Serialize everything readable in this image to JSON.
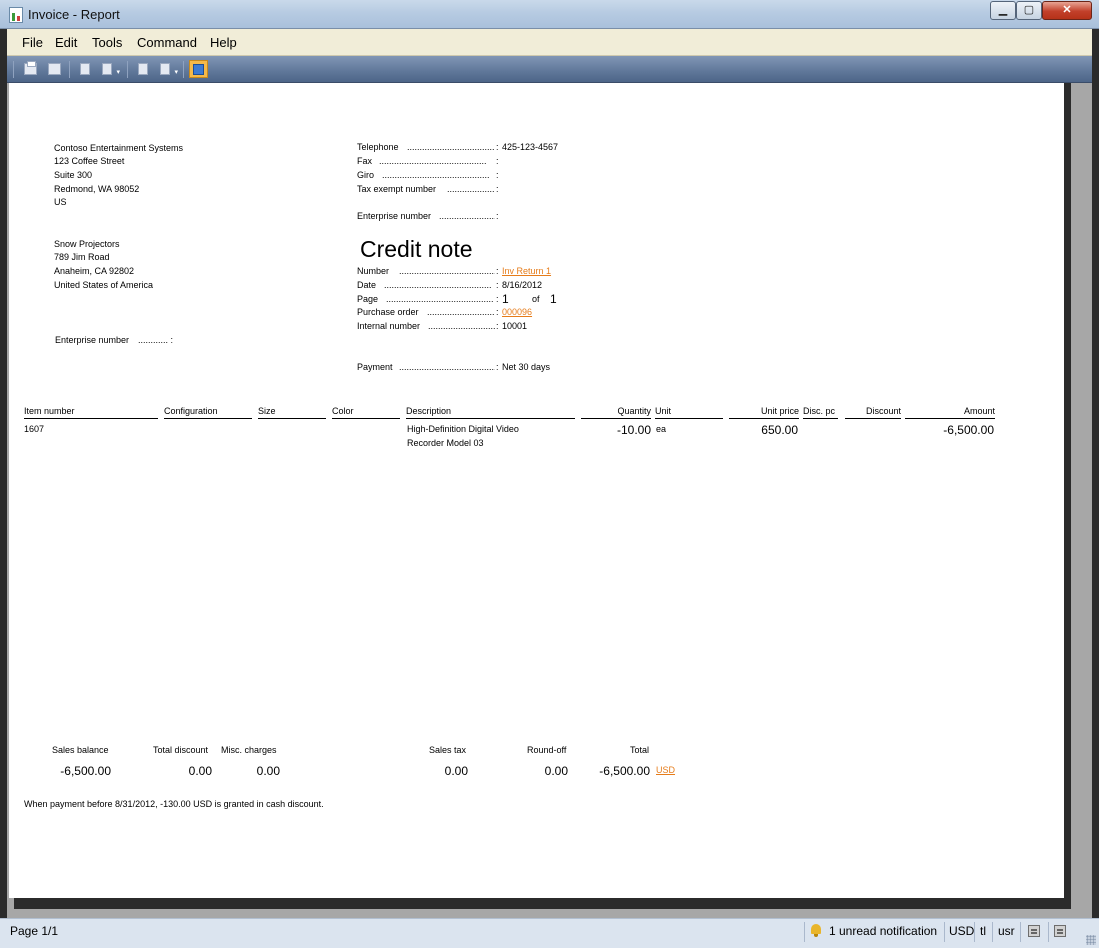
{
  "window": {
    "title": "Invoice - Report",
    "min_glyph": "▁",
    "max_glyph": "▢",
    "close_glyph": "✕"
  },
  "menu": [
    "File",
    "Edit",
    "Tools",
    "Command",
    "Help"
  ],
  "toolbar": {
    "icons": [
      "print-icon",
      "print-preview-icon",
      "first-page-icon",
      "previous-page-icon",
      "next-page-icon",
      "last-page-icon",
      "report-view-icon"
    ],
    "dropdown_glyph": "▾"
  },
  "company": {
    "name": "Contoso Entertainment Systems",
    "street": "123 Coffee Street",
    "suite": "Suite 300",
    "city": "Redmond, WA 98052",
    "country": "US"
  },
  "contact": {
    "telephone_label": "Telephone",
    "telephone_value": "425-123-4567",
    "fax_label": "Fax",
    "giro_label": "Giro",
    "tax_exempt_label": "Tax exempt number",
    "enterprise_label": "Enterprise number"
  },
  "customer": {
    "name": "Snow Projectors",
    "street": "789 Jim Road",
    "city": "Anaheim, CA 92802",
    "country": "United States of America",
    "enterprise_label": "Enterprise number"
  },
  "document": {
    "title": "Credit note",
    "number_label": "Number",
    "number_value": "Inv Return 1",
    "date_label": "Date",
    "date_value": "8/16/2012",
    "page_label": "Page",
    "page_value": "1",
    "page_of": "of",
    "page_total": "1",
    "po_label": "Purchase order",
    "po_value": "000096",
    "internal_label": "Internal number",
    "internal_value": "10001",
    "payment_label": "Payment",
    "payment_value": "Net 30 days",
    "leader_dots": "...........................................",
    "leader_colon": ":",
    "leader_short": "............ :"
  },
  "lines": {
    "headers": [
      "Item number",
      "Configuration",
      "Size",
      "Color",
      "Description",
      "Quantity",
      "Unit",
      "Unit price",
      "Disc. pc",
      "Discount",
      "Amount"
    ],
    "rows": [
      {
        "item_number": "1607",
        "description_1": "High-Definition Digital Video",
        "description_2": "Recorder Model 03",
        "quantity": "-10.00",
        "unit": "ea",
        "unit_price": "650.00",
        "amount": "-6,500.00"
      }
    ]
  },
  "totals": {
    "sales_balance_label": "Sales balance",
    "sales_balance": "-6,500.00",
    "total_discount_label": "Total discount",
    "total_discount": "0.00",
    "misc_charges_label": "Misc. charges",
    "misc_charges": "0.00",
    "sales_tax_label": "Sales tax",
    "sales_tax": "0.00",
    "round_off_label": "Round-off",
    "round_off": "0.00",
    "total_label": "Total",
    "total": "-6,500.00",
    "currency": "USD"
  },
  "cash_discount_note": "When payment before 8/31/2012, -130.00 USD is granted in cash discount.",
  "statusbar": {
    "page": "Page 1/1",
    "notification": "1 unread notification",
    "currency": "USD",
    "company": "tl",
    "user": "usr"
  }
}
